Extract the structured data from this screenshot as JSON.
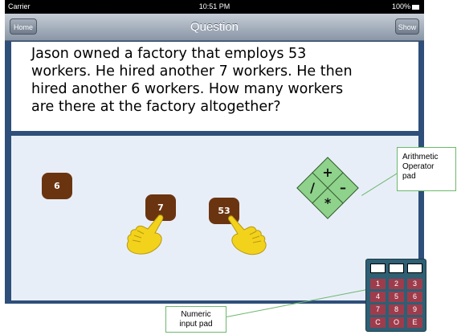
{
  "status_bar": {
    "carrier": "Carrier",
    "time": "10:51 PM",
    "battery": "100%"
  },
  "nav_bar": {
    "title": "Question",
    "home_label": "Home",
    "show_label": "Show"
  },
  "question": {
    "lines": [
      "Jason owned a factory that employs 53",
      "workers. He hired another 7 workers. He then",
      "hired another 6 workers. How many workers",
      "are there at the factory altogether?"
    ]
  },
  "tiles": [
    "6",
    "7",
    "53"
  ],
  "operators": {
    "plus": "+",
    "minus": "–",
    "divide": "/",
    "multiply": "*"
  },
  "callouts": {
    "arithmetic": [
      "Arithmetic",
      "Operator",
      "pad"
    ],
    "numeric": [
      "Numeric",
      "input pad"
    ]
  },
  "numpad": {
    "keys": [
      "1",
      "2",
      "3",
      "4",
      "5",
      "6",
      "7",
      "8",
      "9",
      "C",
      "O",
      "E"
    ]
  },
  "colors": {
    "tile": "#6b3410",
    "operator": "#8ed28c",
    "numpad_key": "#9e3c4c",
    "hand": "#f3d21c",
    "frame": "#2e4f7a"
  }
}
